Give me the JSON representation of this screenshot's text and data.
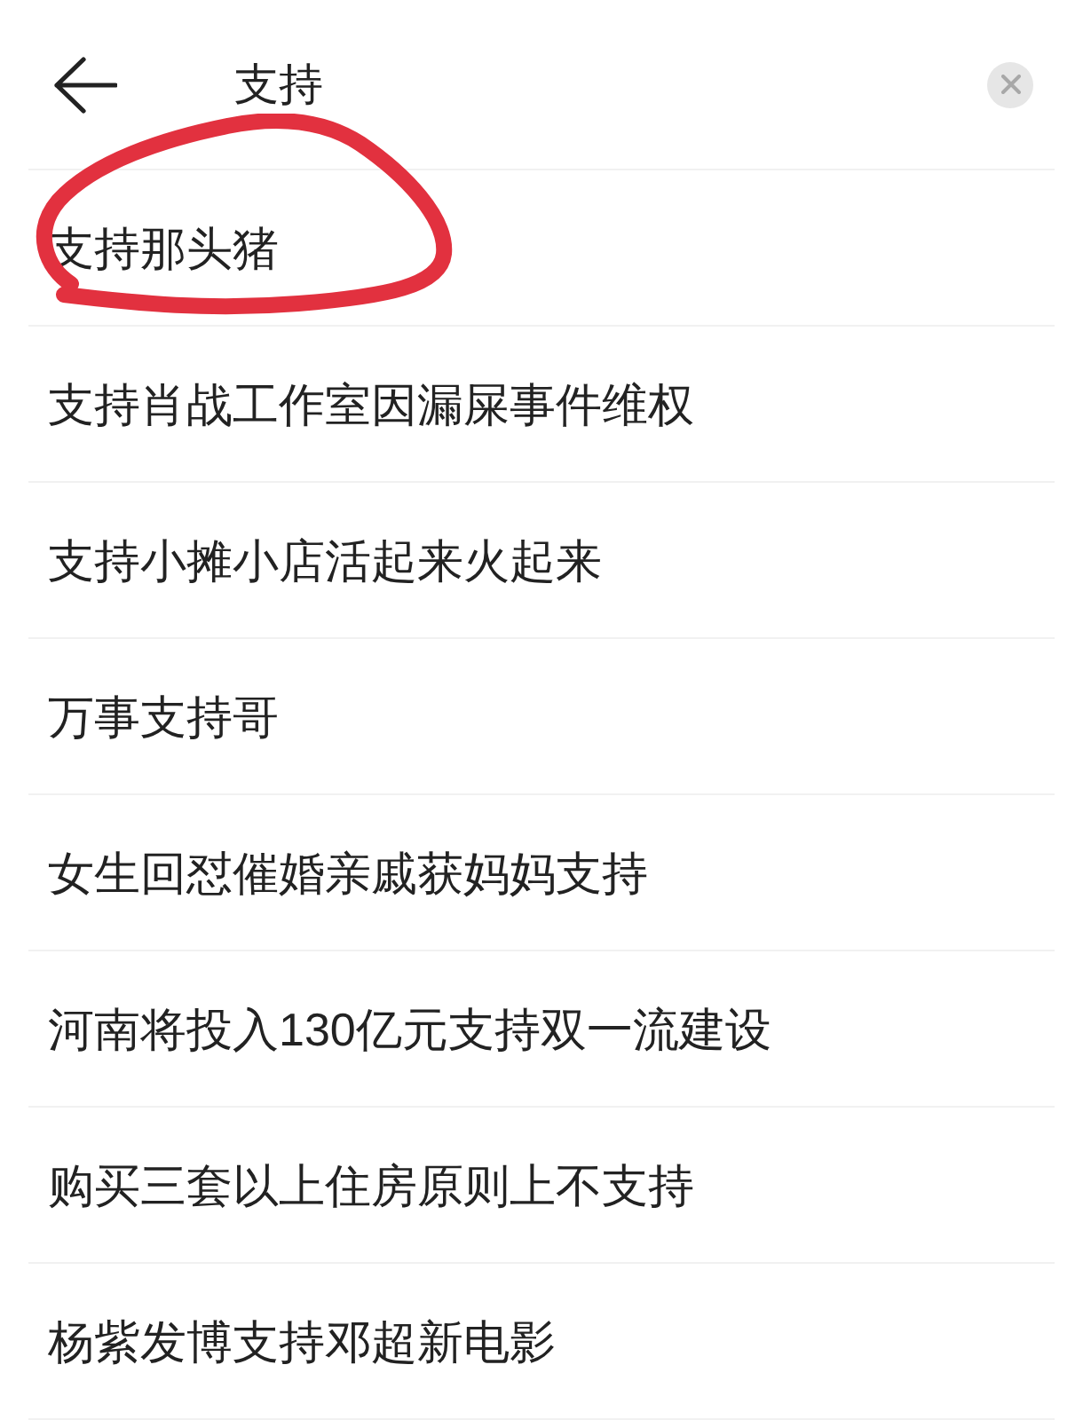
{
  "search": {
    "value": "支持"
  },
  "suggestions": [
    {
      "text": "支持那头猪",
      "circled": true
    },
    {
      "text": "支持肖战工作室因漏屎事件维权",
      "circled": false
    },
    {
      "text": "支持小摊小店活起来火起来",
      "circled": false
    },
    {
      "text": "万事支持哥",
      "circled": false
    },
    {
      "text": "女生回怼催婚亲戚获妈妈支持",
      "circled": false
    },
    {
      "text": "河南将投入130亿元支持双一流建设",
      "circled": false
    },
    {
      "text": "购买三套以上住房原则上不支持",
      "circled": false
    },
    {
      "text": "杨紫发博支持邓超新电影",
      "circled": false
    }
  ]
}
